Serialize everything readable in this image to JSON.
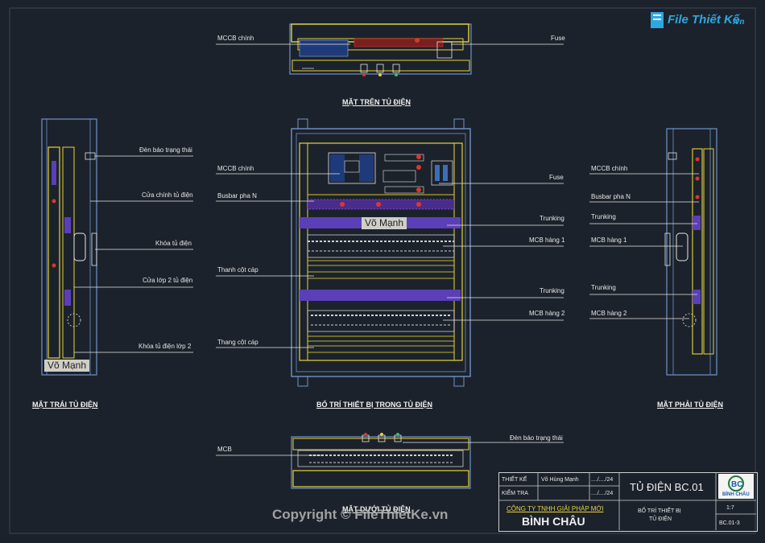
{
  "logo": {
    "brand": "File Thiết Kế",
    "suffix": ".vn"
  },
  "views": {
    "top": "MẶT TRÊN TỦ ĐIỆN",
    "left": "MẶT TRÁI TỦ ĐIỆN",
    "front": "BỐ TRÍ THIẾT BỊ TRONG TỦ ĐIỆN",
    "right": "MẶT PHẢI TỦ ĐIỆN",
    "bottom": "MẶT DƯỚI TỦ ĐIỆN"
  },
  "top_labels": {
    "mccb": "MCCB chính",
    "fuse": "Fuse"
  },
  "left_labels": {
    "den_bao": "Đèn báo trạng thái",
    "cua_chinh": "Cửa chính tủ điện",
    "khoa": "Khóa tủ điện",
    "cua_lop2": "Cửa lớp 2 tủ điện",
    "khoa_lop2": "Khóa tủ điện lớp 2"
  },
  "front_left_labels": {
    "mccb": "MCCB chính",
    "busbar": "Busbar pha N",
    "thanh_cot": "Thanh cột cáp",
    "thang_cot": "Thang cột cáp"
  },
  "front_right_labels": {
    "fuse": "Fuse",
    "trunking1": "Trunking",
    "mcb1": "MCB hàng 1",
    "trunking2": "Trunking",
    "mcb2": "MCB hàng 2"
  },
  "right_labels": {
    "mccb": "MCCB chính",
    "busbar": "Busbar pha N",
    "trunking1": "Trunking",
    "mcb1": "MCB hàng 1",
    "trunking2": "Trunking",
    "mcb2": "MCB hàng 2"
  },
  "bottom_labels": {
    "mcb": "MCB",
    "den_bao": "Đèn báo trạng thái"
  },
  "name_tag": "Võ Mạnh",
  "title_block": {
    "thiet_ke": "THIẾT KẾ",
    "kiem_tra": "KIỂM TRA",
    "designer": "Võ Hùng Mạnh",
    "date1": "..../..../24",
    "date2": "..../..../24",
    "company_line1": "CÔNG TY TNHH GIẢI PHÁP MỚI",
    "company_line2": "BÌNH CHÂU",
    "drawing_title": "TỦ ĐIỆN BC.01",
    "sheet_title_1": "BỐ TRÍ THIẾT BỊ",
    "sheet_title_2": "TỦ ĐIỆN",
    "scale": "1:7",
    "sheet_no": "BC.01-3",
    "logo_text": "BÌNH CHÂU"
  },
  "copyright": "Copyright © FileThietKe.vn",
  "colors": {
    "background": "#1c222b",
    "frame": "#6f93c9",
    "yellow": "#e7d43a",
    "purple": "#5b3fb8",
    "red": "#d8392d"
  }
}
